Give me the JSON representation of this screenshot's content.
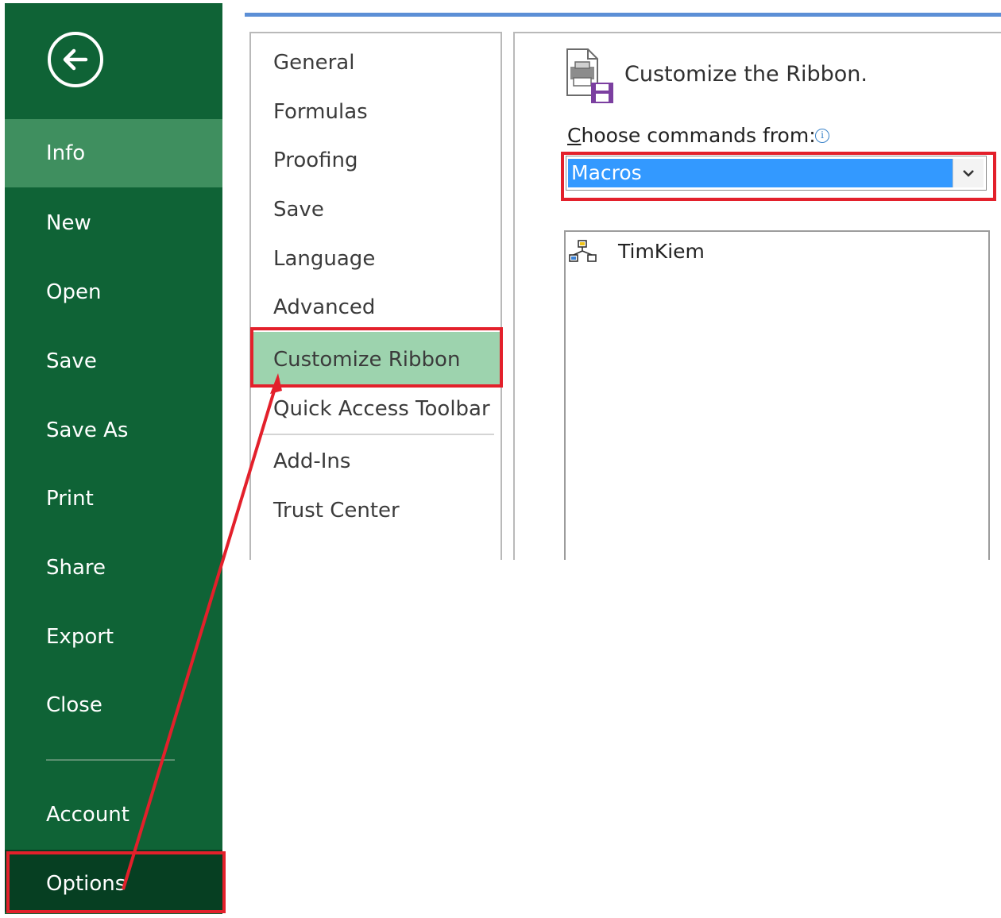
{
  "backstage": {
    "nav_items": [
      {
        "label": "Info"
      },
      {
        "label": "New"
      },
      {
        "label": "Open"
      },
      {
        "label": "Save"
      },
      {
        "label": "Save As"
      },
      {
        "label": "Print"
      },
      {
        "label": "Share"
      },
      {
        "label": "Export"
      },
      {
        "label": "Close"
      },
      {
        "label": "Account"
      },
      {
        "label": "Options"
      }
    ],
    "active_item": "Info",
    "background_color": "#0f6336"
  },
  "options_dialog": {
    "categories": [
      {
        "label": "General"
      },
      {
        "label": "Formulas"
      },
      {
        "label": "Proofing"
      },
      {
        "label": "Save"
      },
      {
        "label": "Language"
      },
      {
        "label": "Advanced"
      },
      {
        "label": "Customize Ribbon"
      },
      {
        "label": "Quick Access Toolbar"
      },
      {
        "label": "Add-Ins"
      },
      {
        "label": "Trust Center"
      }
    ],
    "selected_category": "Customize Ribbon",
    "panel": {
      "title": "Customize the Ribbon.",
      "choose_label_first": "C",
      "choose_label_rest": "hoose commands from:",
      "info_glyph": "i",
      "dropdown_value": "Macros",
      "commands": [
        {
          "label": "TimKiem",
          "icon": "macro-icon"
        }
      ]
    }
  },
  "annotations": {
    "highlight_color": "#e3202b",
    "highlighted": [
      "Options",
      "Customize Ribbon",
      "Macros"
    ]
  }
}
